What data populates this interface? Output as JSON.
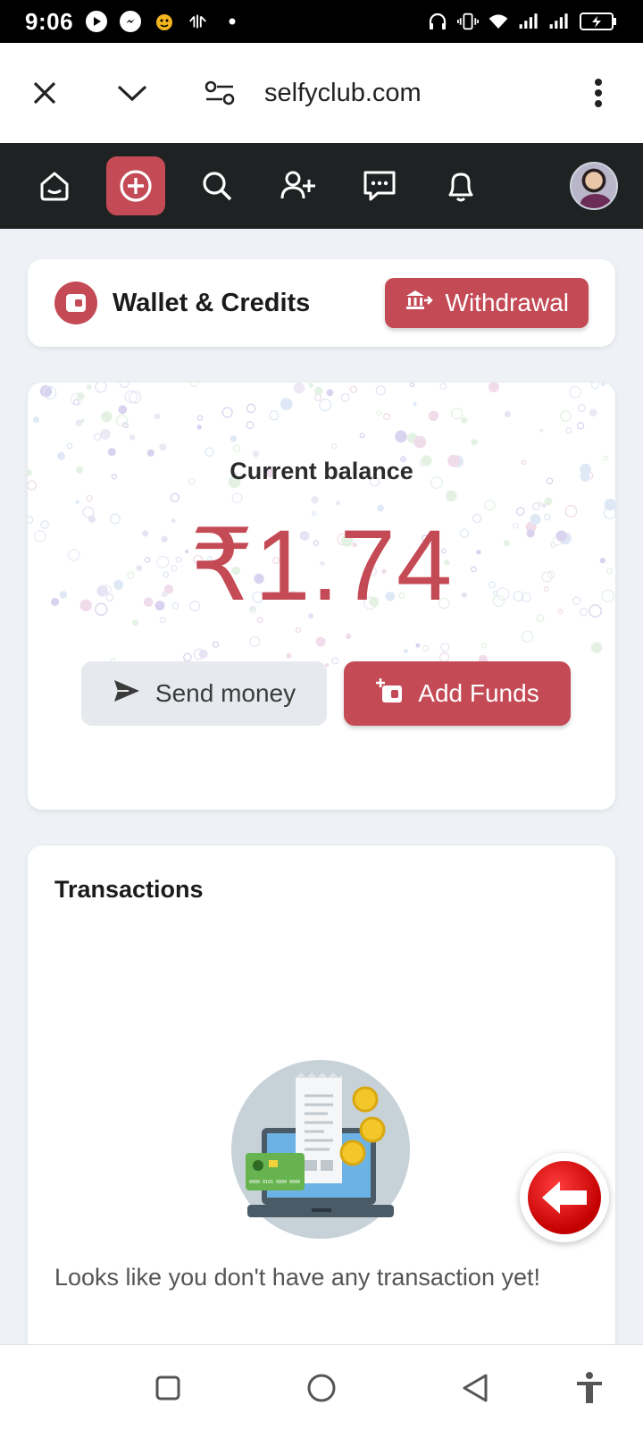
{
  "status_bar": {
    "time": "9:06",
    "icons": [
      "play-icon",
      "messenger-icon",
      "emoji-icon",
      "gesture-icon",
      "dot-icon",
      "headset-icon",
      "vibrate-icon",
      "wifi-icon",
      "signal-icon",
      "signal-icon",
      "battery-charging-icon"
    ]
  },
  "browser": {
    "url": "selfyclub.com",
    "icons": [
      "close-icon",
      "chevron-down-icon",
      "site-settings-icon",
      "more-vert-icon"
    ]
  },
  "nav": {
    "items": [
      "home-icon",
      "create-icon",
      "search-icon",
      "add-friend-icon",
      "messages-icon",
      "notifications-icon"
    ],
    "active_index": 1,
    "accent_color": "#c44a55"
  },
  "wallet": {
    "title": "Wallet & Credits",
    "withdraw_label": "Withdrawal"
  },
  "balance": {
    "label": "Current balance",
    "amount": "₹1.74",
    "send_label": "Send money",
    "add_label": "Add Funds"
  },
  "transactions": {
    "title": "Transactions",
    "empty_message": "Looks like you don't have any transaction yet!",
    "card_number_text": "0000 0101 0000 0000"
  },
  "colors": {
    "brand": "#c44a55",
    "nav_bg": "#1f2223",
    "page_bg": "#eef1f5"
  }
}
